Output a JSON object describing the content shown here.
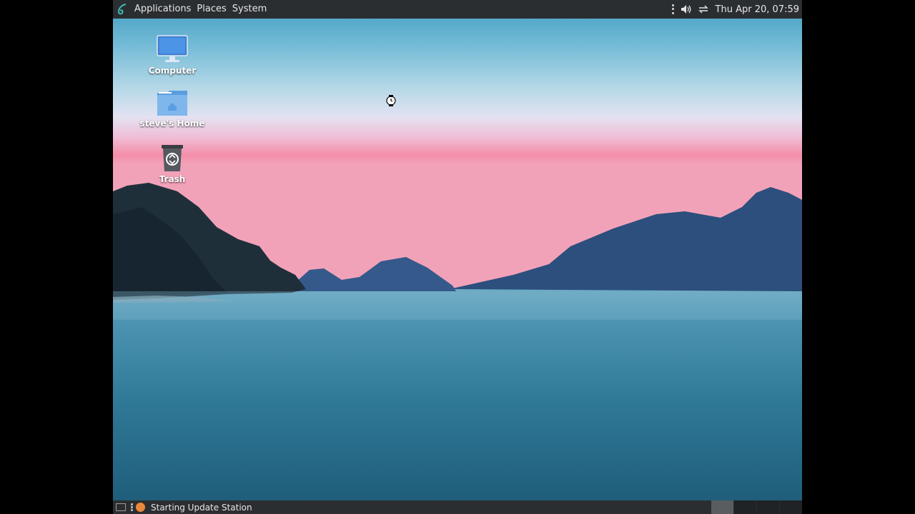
{
  "top_panel": {
    "menus": [
      "Applications",
      "Places",
      "System"
    ],
    "clock": "Thu Apr 20, 07:59",
    "tray_icons": [
      "volume-icon",
      "network-icon"
    ]
  },
  "desktop": {
    "icons": [
      {
        "label": "Computer",
        "icon": "computer-icon"
      },
      {
        "label": "steve's Home",
        "icon": "home-folder-icon"
      },
      {
        "label": "Trash",
        "icon": "trash-icon"
      }
    ]
  },
  "bottom_panel": {
    "task_label": "Starting Update Station",
    "workspaces": 4,
    "active_workspace": 1
  },
  "colors": {
    "panel": "#2b2e31",
    "task_icon": "#e8883a"
  }
}
